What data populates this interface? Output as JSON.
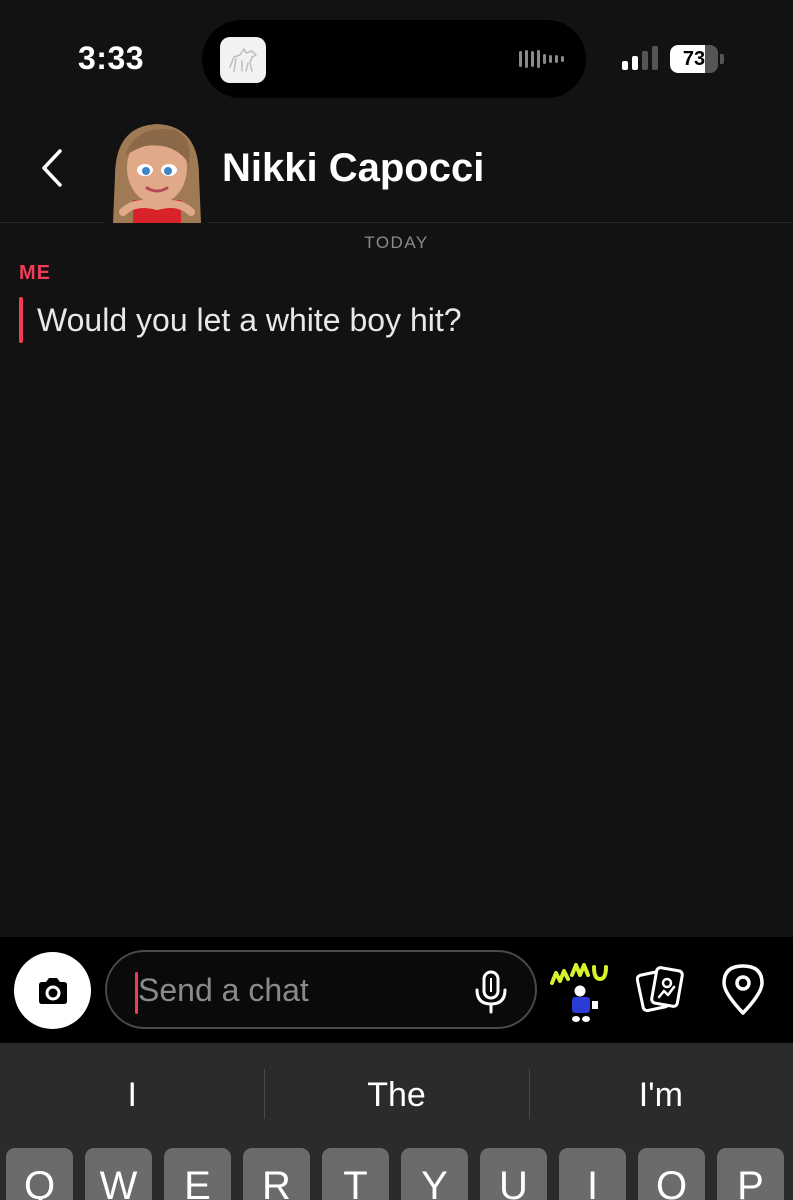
{
  "status_bar": {
    "time": "3:33",
    "battery_level": "73",
    "battery_fraction": 0.73,
    "signal_bars": 4,
    "signal_active_bars": 2,
    "island_app_icon": "horse-icon"
  },
  "header": {
    "back_icon": "chevron-left-icon",
    "contact_name": "Nikki Capocci",
    "avatar": "bitmoji-avatar"
  },
  "chat": {
    "date_label": "TODAY",
    "messages": [
      {
        "sender": "ME",
        "text": "Would you let a white boy hit?"
      }
    ]
  },
  "input_bar": {
    "camera_icon": "camera-icon",
    "placeholder": "Send a chat",
    "mic_icon": "microphone-icon",
    "bitmoji_sticker_text": "HMU",
    "memories_icon": "photo-cards-icon",
    "location_icon": "map-pin-icon"
  },
  "keyboard": {
    "suggestions": [
      "I",
      "The",
      "I'm"
    ],
    "row1": [
      "Q",
      "W",
      "E",
      "R",
      "T",
      "Y",
      "U",
      "I",
      "O",
      "P"
    ]
  },
  "colors": {
    "background": "#121212",
    "accent": "#f23c57",
    "keyboard_bg": "#2b2b2b",
    "key_bg": "#6b6b6b"
  }
}
